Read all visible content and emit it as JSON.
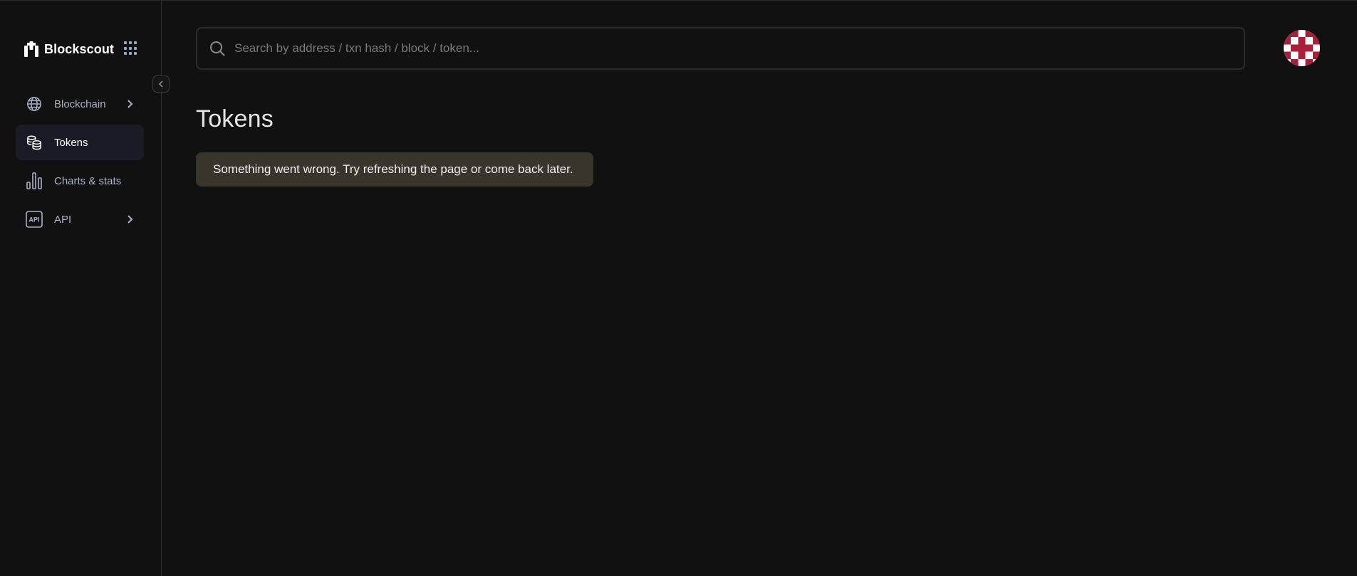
{
  "brand": {
    "name": "Blockscout"
  },
  "sidebar": {
    "items": [
      {
        "label": "Blockchain",
        "icon": "globe-icon",
        "has_submenu": true,
        "active": false
      },
      {
        "label": "Tokens",
        "icon": "coins-icon",
        "has_submenu": false,
        "active": true
      },
      {
        "label": "Charts & stats",
        "icon": "bar-chart-icon",
        "has_submenu": false,
        "active": false
      },
      {
        "label": "API",
        "icon": "api-icon",
        "has_submenu": true,
        "active": false
      }
    ]
  },
  "search": {
    "placeholder": "Search by address / txn hash / block / token..."
  },
  "main": {
    "title": "Tokens",
    "alert": "Something went wrong. Try refreshing the page or come back later."
  },
  "colors": {
    "background": "#111111",
    "active_nav_bg": "#1a1c25",
    "alert_bg": "#3a352c",
    "avatar_primary": "#a8203a"
  }
}
